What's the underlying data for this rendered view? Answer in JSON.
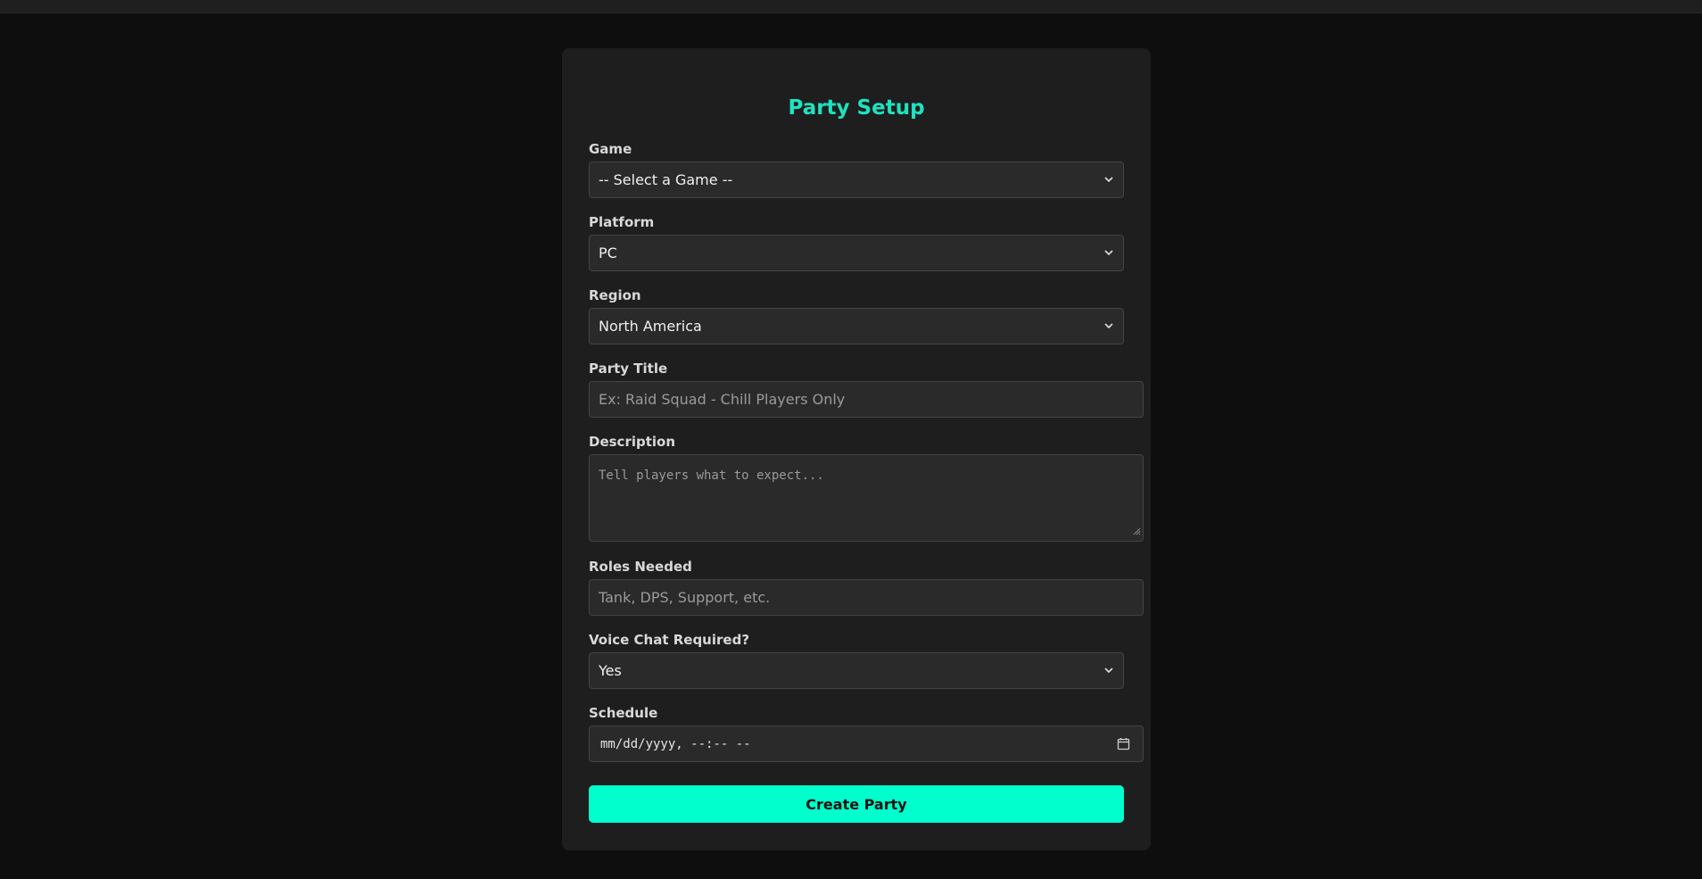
{
  "form": {
    "title": "Party Setup",
    "game": {
      "label": "Game",
      "value": "-- Select a Game --"
    },
    "platform": {
      "label": "Platform",
      "value": "PC"
    },
    "region": {
      "label": "Region",
      "value": "North America"
    },
    "party_title": {
      "label": "Party Title",
      "placeholder": "Ex: Raid Squad - Chill Players Only"
    },
    "description": {
      "label": "Description",
      "placeholder": "Tell players what to expect..."
    },
    "roles": {
      "label": "Roles Needed",
      "placeholder": "Tank, DPS, Support, etc."
    },
    "voice_chat": {
      "label": "Voice Chat Required?",
      "value": "Yes"
    },
    "schedule": {
      "label": "Schedule",
      "value": "mm/dd/yyyy, --:-- --"
    },
    "submit_label": "Create Party"
  },
  "icons": {
    "select_chevron": "chevron-down-icon",
    "calendar": "calendar-icon",
    "resize": "resize-grip-icon"
  },
  "colors": {
    "accent": "#00ffcc",
    "title": "#1ee3c0",
    "card_bg": "#1e1e1e",
    "page_bg": "#0e0e0e"
  }
}
